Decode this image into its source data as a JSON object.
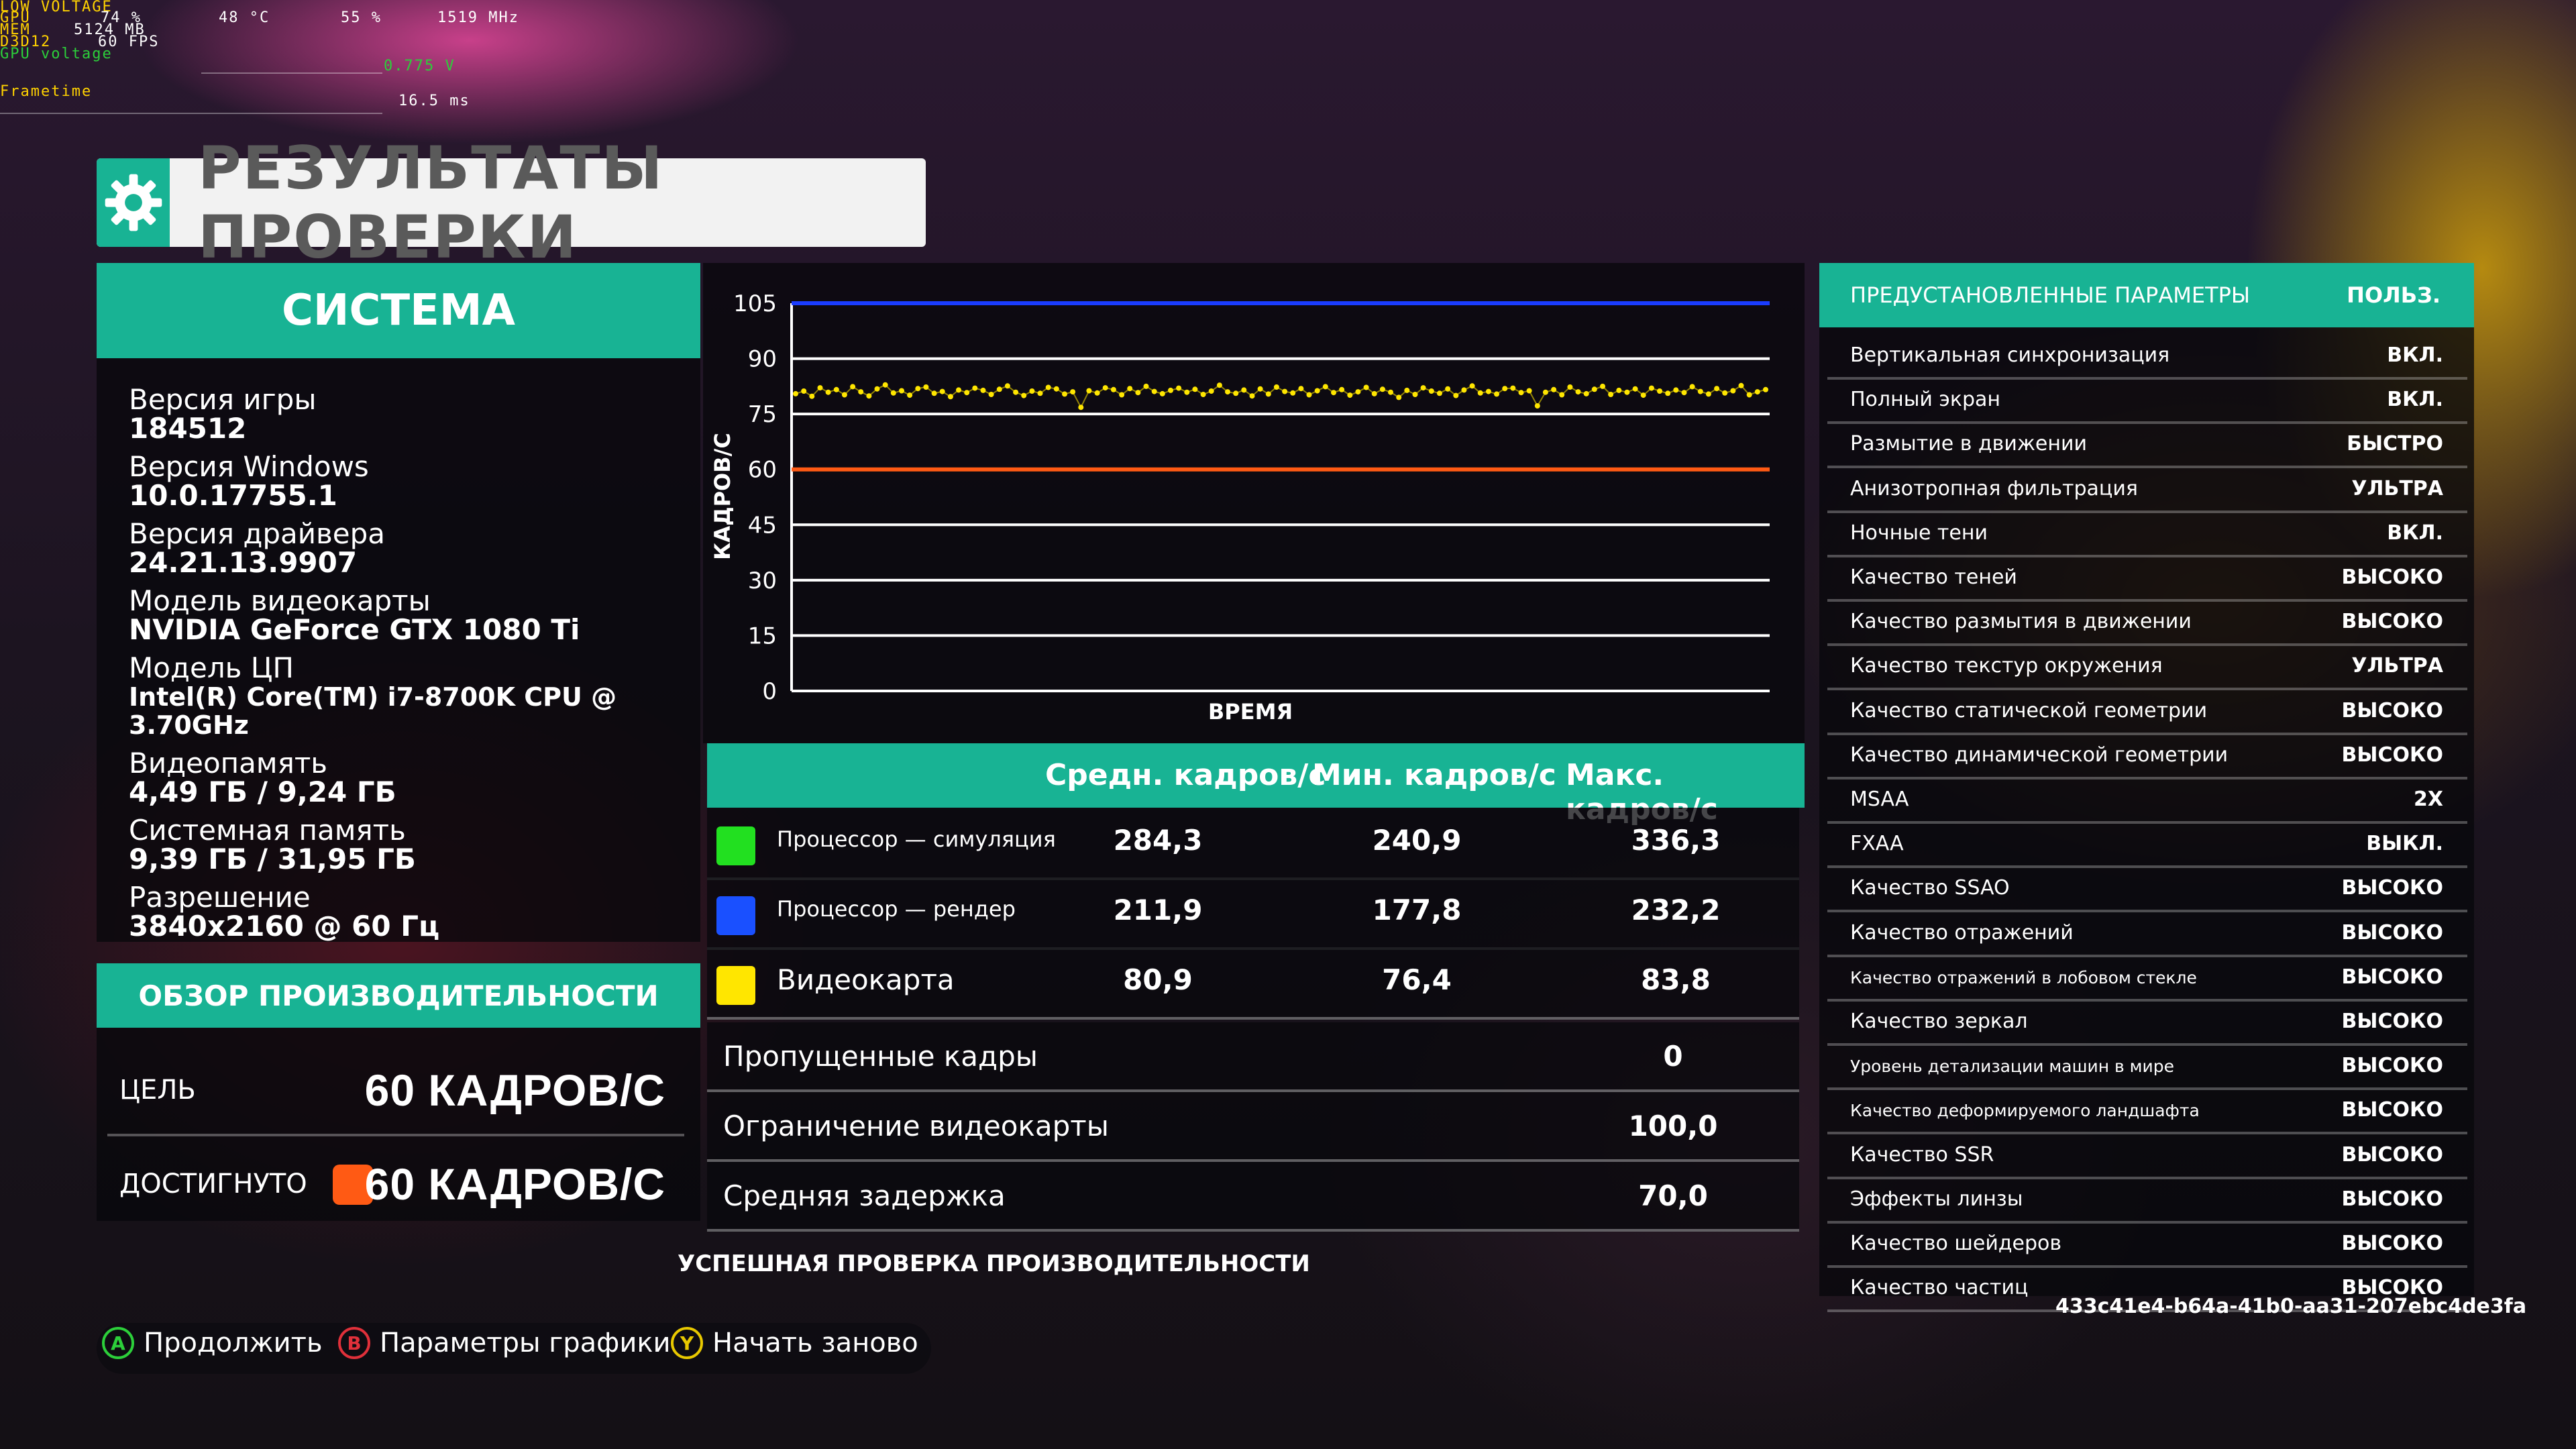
{
  "osd": {
    "low_voltage": "LOW VOLTAGE",
    "gpu_label": "GPU",
    "gpu_load": "74 %",
    "gpu_temp": "48 °C",
    "gpu_fan": "55 %",
    "gpu_clock": "1519 MHz",
    "mem_label": "MEM",
    "mem_value": "5124 MB",
    "api_label": "D3D12",
    "fps_value": "60 FPS",
    "voltage_label": "GPU voltage",
    "voltage_value": "0.775 V",
    "frametime_label": "Frametime",
    "frametime_value": "16.5 ms"
  },
  "title": "РЕЗУЛЬТАТЫ ПРОВЕРКИ",
  "system": {
    "header": "СИСТЕМА",
    "items": [
      {
        "label": "Версия игры",
        "value": "184512"
      },
      {
        "label": "Версия Windows",
        "value": "10.0.17755.1"
      },
      {
        "label": "Версия драйвера",
        "value": "24.21.13.9907"
      },
      {
        "label": "Модель видеокарты",
        "value": "NVIDIA GeForce GTX 1080 Ti"
      },
      {
        "label": "Модель ЦП",
        "value": "Intel(R) Core(TM) i7-8700K CPU @ 3.70GHz"
      },
      {
        "label": "Видеопамять",
        "value": "4,49 ГБ / 9,24 ГБ"
      },
      {
        "label": "Системная память",
        "value": "9,39 ГБ / 31,95 ГБ"
      },
      {
        "label": "Разрешение",
        "value": "3840x2160 @ 60 Гц"
      }
    ]
  },
  "performance": {
    "header": "ОБЗОР ПРОИЗВОДИТЕЛЬНОСТИ",
    "target_label": "ЦЕЛЬ",
    "target_value": "60 КАДРОВ/С",
    "achieved_label": "ДОСТИГНУТО",
    "achieved_value": "60 КАДРОВ/С",
    "achieved_color": "#ff5a14"
  },
  "chart_data": {
    "type": "line",
    "xlabel": "ВРЕМЯ",
    "ylabel": "КАДРОВ/С",
    "ylim": [
      0,
      105
    ],
    "yticks": [
      0,
      15,
      30,
      45,
      60,
      75,
      90,
      105
    ],
    "grid": true,
    "series": [
      {
        "name": "Процессор — рендер",
        "color": "#1a3cff",
        "constant": 105,
        "style": "line"
      },
      {
        "name": "Цель",
        "color": "#ff5a14",
        "constant": 60,
        "style": "line"
      },
      {
        "name": "Видеокарта",
        "color": "#ffe600",
        "style": "scatter",
        "mean": 80.9,
        "min": 76.4,
        "max": 83.8,
        "values": [
          80.5,
          81.2,
          79.8,
          82.1,
          80.9,
          81.6,
          80.2,
          82.4,
          81.0,
          79.9,
          81.8,
          82.9,
          80.7,
          81.3,
          80.1,
          81.9,
          82.3,
          80.6,
          81.1,
          79.7,
          81.5,
          80.8,
          82.0,
          81.4,
          80.3,
          81.7,
          82.6,
          80.9,
          80.0,
          81.2,
          80.6,
          82.2,
          81.8,
          80.4,
          81.0,
          76.8,
          81.3,
          80.7,
          82.1,
          81.6,
          80.2,
          81.9,
          80.8,
          82.5,
          81.1,
          80.5,
          81.4,
          82.0,
          80.9,
          81.7,
          80.3,
          81.2,
          82.8,
          81.0,
          80.6,
          81.5,
          79.9,
          81.8,
          80.4,
          82.3,
          81.1,
          80.7,
          81.9,
          80.2,
          81.3,
          82.4,
          80.8,
          81.6,
          80.1,
          81.0,
          82.2,
          80.5,
          81.7,
          80.9,
          79.5,
          81.4,
          80.3,
          82.1,
          81.2,
          80.6,
          81.8,
          80.0,
          81.5,
          82.6,
          80.7,
          81.1,
          80.4,
          81.9,
          82.0,
          80.8,
          81.3,
          77.2,
          80.9,
          81.6,
          80.2,
          82.3,
          81.0,
          80.5,
          81.7,
          82.5,
          80.3,
          81.4,
          80.9,
          81.8,
          80.1,
          82.0,
          81.2,
          80.6,
          81.5,
          80.8,
          82.4,
          81.1,
          80.4,
          81.9,
          80.7,
          81.3,
          82.7,
          80.2,
          81.0,
          81.6
        ]
      }
    ]
  },
  "stats": {
    "col_avg": "Средн. кадров/с",
    "col_min": "Мин. кадров/с",
    "col_max": "Макс. кадров/с",
    "rows": [
      {
        "name": "Процессор — симуляция",
        "color": "#22e020",
        "avg": "284,3",
        "min": "240,9",
        "max": "336,3"
      },
      {
        "name": "Процессор — рендер",
        "color": "#1a50ff",
        "avg": "211,9",
        "min": "177,8",
        "max": "232,2"
      },
      {
        "name": "Видеокарта",
        "color": "#ffe600",
        "avg": "80,9",
        "min": "76,4",
        "max": "83,8"
      }
    ],
    "extra": [
      {
        "name": "Пропущенные кадры",
        "value": "0"
      },
      {
        "name": "Ограничение видеокарты",
        "value": "100,0"
      },
      {
        "name": "Средняя задержка",
        "value": "70,0"
      }
    ],
    "status": "УСПЕШНАЯ ПРОВЕРКА ПРОИЗВОДИТЕЛЬНОСТИ"
  },
  "presets": {
    "header": "ПРЕДУСТАНОВЛЕННЫЕ ПАРАМЕТРЫ",
    "header_value": "ПОЛЬЗ.",
    "rows": [
      {
        "name": "Вертикальная синхронизация",
        "value": "ВКЛ."
      },
      {
        "name": "Полный экран",
        "value": "ВКЛ."
      },
      {
        "name": "Размытие в движении",
        "value": "БЫСТРО"
      },
      {
        "name": "Анизотропная фильтрация",
        "value": "УЛЬТРА"
      },
      {
        "name": "Ночные тени",
        "value": "ВКЛ."
      },
      {
        "name": "Качество теней",
        "value": "ВЫСОКО"
      },
      {
        "name": "Качество размытия в движении",
        "value": "ВЫСОКО"
      },
      {
        "name": "Качество текстур окружения",
        "value": "УЛЬТРА"
      },
      {
        "name": "Качество статической геометрии",
        "value": "ВЫСОКО"
      },
      {
        "name": "Качество динамической геометрии",
        "value": "ВЫСОКО"
      },
      {
        "name": "MSAA",
        "value": "2X"
      },
      {
        "name": "FXAA",
        "value": "ВЫКЛ."
      },
      {
        "name": "Качество SSAO",
        "value": "ВЫСОКО"
      },
      {
        "name": "Качество отражений",
        "value": "ВЫСОКО"
      },
      {
        "name": "Качество отражений в лобовом стекле",
        "value": "ВЫСОКО"
      },
      {
        "name": "Качество зеркал",
        "value": "ВЫСОКО"
      },
      {
        "name": "Уровень детализации машин в мире",
        "value": "ВЫСОКО"
      },
      {
        "name": "Качество деформируемого ландшафта",
        "value": "ВЫСОКО"
      },
      {
        "name": "Качество SSR",
        "value": "ВЫСОКО"
      },
      {
        "name": "Эффекты линзы",
        "value": "ВЫСОКО"
      },
      {
        "name": "Качество шейдеров",
        "value": "ВЫСОКО"
      },
      {
        "name": "Качество частиц",
        "value": "ВЫСОКО"
      }
    ],
    "session_id": "433c41e4-b64a-41b0-aa31-207ebc4de3fa"
  },
  "footer": {
    "continue_key": "A",
    "continue_label": "Продолжить",
    "continue_color": "#2ccf3a",
    "graphics_key": "B",
    "graphics_label": "Параметры графики",
    "graphics_color": "#e0303a",
    "restart_key": "Y",
    "restart_label": "Начать заново",
    "restart_color": "#e8c800"
  }
}
